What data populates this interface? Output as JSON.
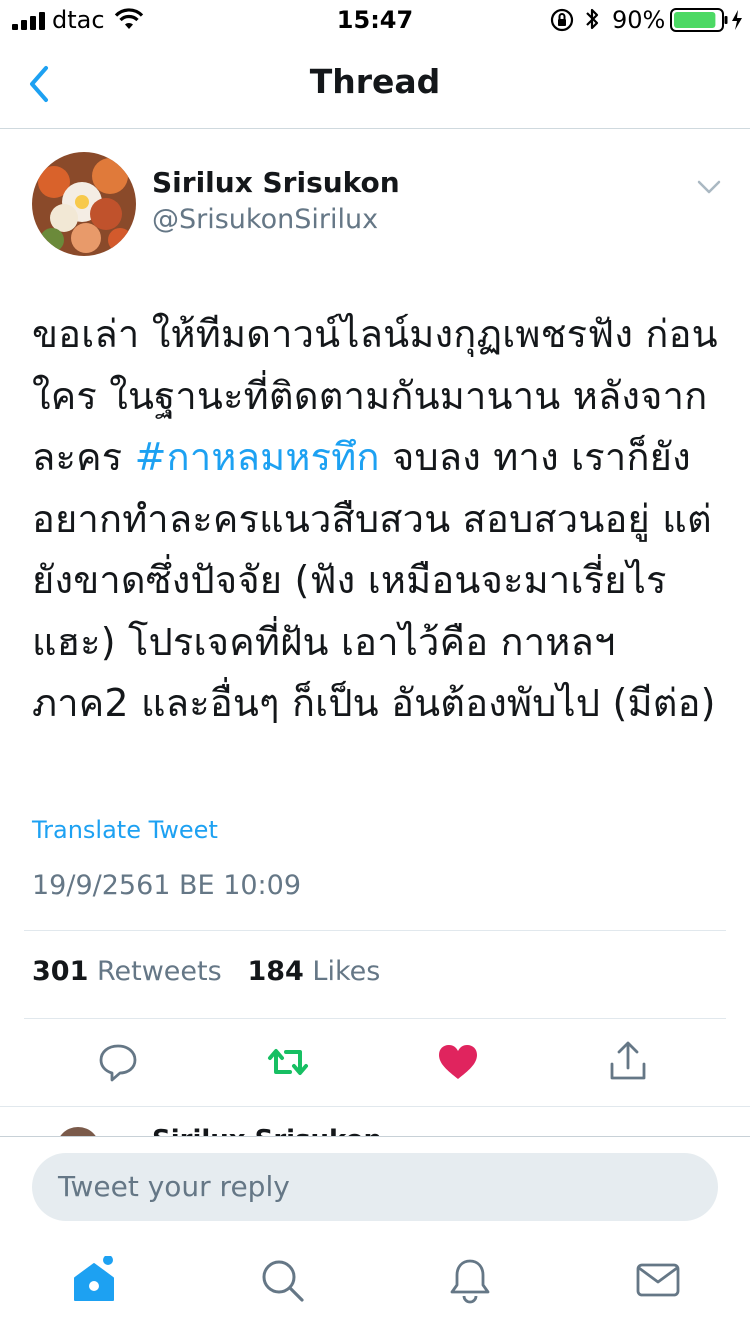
{
  "status_bar": {
    "carrier": "dtac",
    "time": "15:47",
    "battery_percent": "90%",
    "battery_level": 0.9
  },
  "nav": {
    "back_icon": "chevron-left-icon",
    "title": "Thread"
  },
  "tweet": {
    "author_name": "Sirilux Srisukon",
    "author_handle": "@SrisukonSirilux",
    "text_before": "ขอเล่า ให้ทีมดาวน์ไลน์มงกุฏเพชรฟัง ก่อน ใคร ในฐานะที่ติดตามกันมานาน หลังจากละคร ",
    "hashtag": "#กาหลมหรทึก",
    "text_after": " จบลง ทาง เราก็ยังอยากทำละครแนวสืบสวน สอบสวนอยู่ แต่ยังขาดซึ่งปัจจัย (ฟัง เหมือนจะมาเรี่ยไรแฮะ) โปรเจคที่ฝัน เอาไว้คือ กาหลฯ ภาค2 และอื่นๆ ก็เป็น อันต้องพับไป (มีต่อ)",
    "translate_label": "Translate Tweet",
    "timestamp": "19/9/2561 BE 10:09",
    "retweet_count": "301",
    "retweet_label": "Retweets",
    "like_count": "184",
    "like_label": "Likes",
    "liked": true,
    "colors": {
      "link": "#1da1f2",
      "retweet_active": "#17bf63",
      "like_active": "#e0245e"
    }
  },
  "next_tweet_peek": {
    "author_name": "Sirilux Srisukon"
  },
  "reply": {
    "placeholder": "Tweet your reply"
  },
  "tab_bar": {
    "items": [
      "home-icon",
      "search-icon",
      "notifications-icon",
      "messages-icon"
    ],
    "active": "home-icon",
    "active_color": "#1da1f2"
  }
}
